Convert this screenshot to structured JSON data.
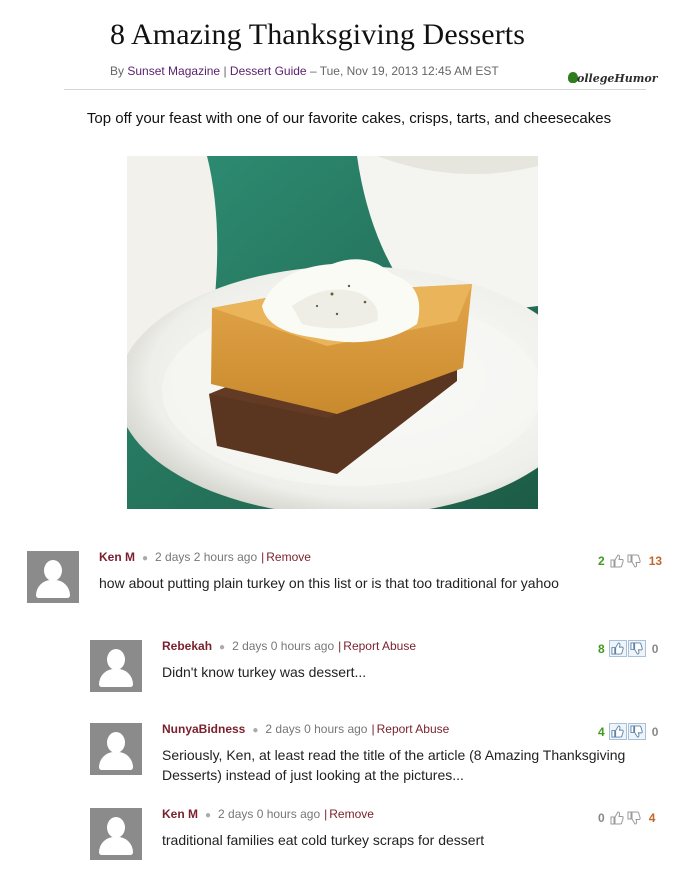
{
  "article": {
    "title": "8 Amazing Thanksgiving Desserts",
    "byline": {
      "prefix": "By",
      "author": "Sunset Magazine",
      "separator": "|",
      "section": "Dessert Guide",
      "date": "– Tue, Nov 19, 2013 12:45 AM EST"
    },
    "logo_text": "ollegeHumor",
    "subtitle": "Top off your feast with one of our favorite cakes, crisps, tarts, and cheesecakes"
  },
  "comments": [
    {
      "author": "Ken M",
      "time": "2 days 2 hours ago",
      "action": "Remove",
      "text": "how about putting plain turkey on this list or is that too traditional for yahoo",
      "up": "2",
      "down": "13"
    },
    {
      "author": "Rebekah",
      "time": "2 days 0 hours ago",
      "action": "Report Abuse",
      "text": "Didn't know turkey was dessert...",
      "up": "8",
      "down": "0"
    },
    {
      "author": "NunyaBidness",
      "time": "2 days 0 hours ago",
      "action": "Report Abuse",
      "text": "Seriously, Ken, at least read the title of the article (8 Amazing Thanksgiving Desserts) instead of just looking at the pictures...",
      "up": "4",
      "down": "0"
    },
    {
      "author": "Ken M",
      "time": "2 days 0 hours ago",
      "action": "Remove",
      "text": "traditional families eat cold turkey scraps for dessert",
      "up": "0",
      "down": "4"
    }
  ],
  "icons": {
    "avatar": "default-user-avatar-icon",
    "thumbs_up": "thumbs-up-icon",
    "thumbs_down": "thumbs-down-icon",
    "logo": "collegehumor-logo-icon"
  },
  "colors": {
    "author": "#7a1f2b",
    "up_count": "#3f9b1e",
    "down_count": "#c0672a",
    "avatar_bg": "#8b8b8b"
  }
}
